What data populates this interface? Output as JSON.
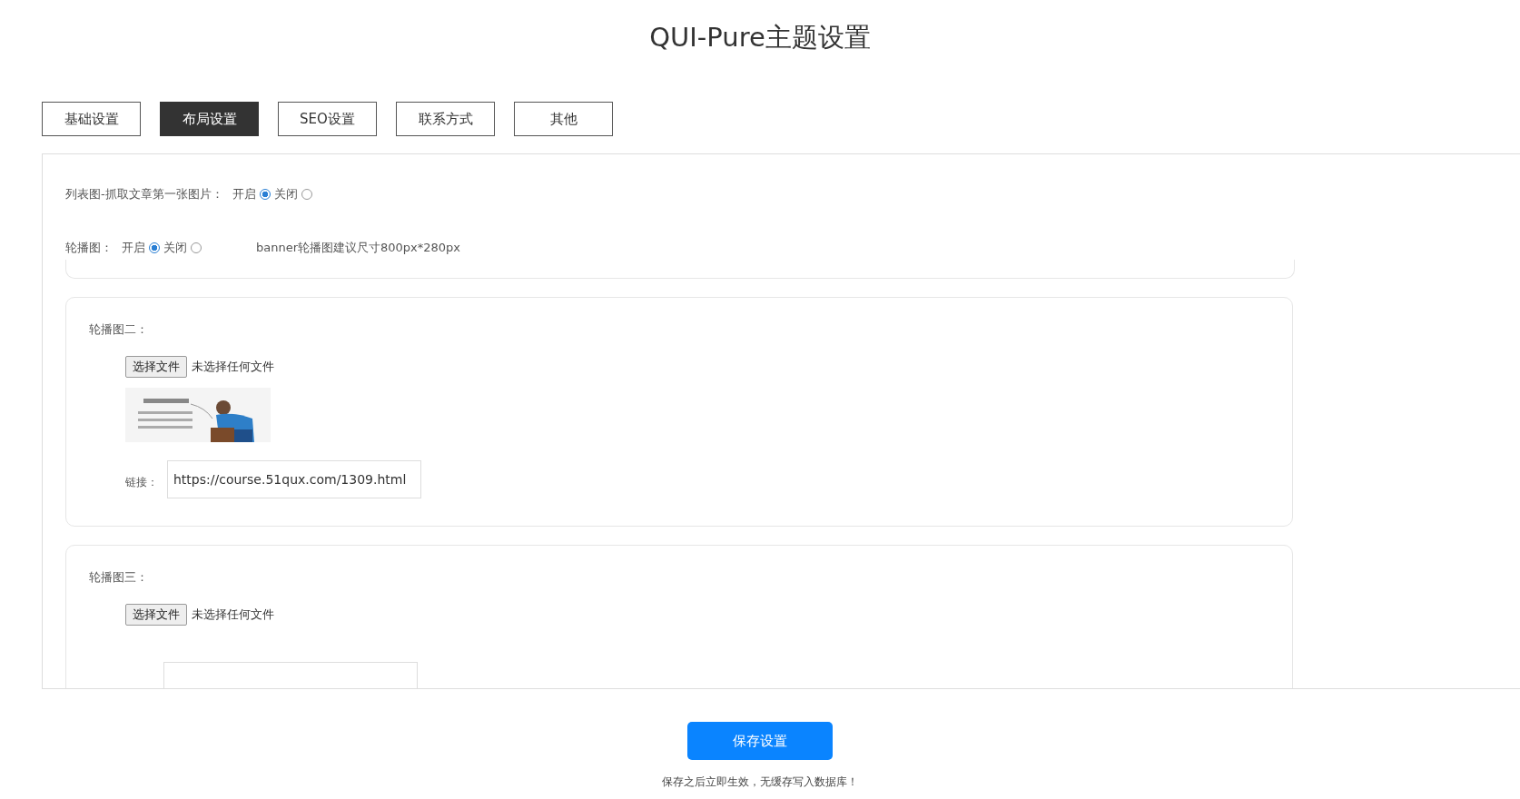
{
  "title": "QUI-Pure主题设置",
  "tabs": [
    {
      "label": "基础设置",
      "selected": false
    },
    {
      "label": "布局设置",
      "selected": true
    },
    {
      "label": "SEO设置",
      "selected": false
    },
    {
      "label": "联系方式",
      "selected": false
    },
    {
      "label": "其他",
      "selected": false
    }
  ],
  "settings": [
    {
      "label": "列表图-抓取文章第一张图片：",
      "options": [
        {
          "label": "开启",
          "selected": true
        },
        {
          "label": "关闭",
          "selected": false
        }
      ]
    },
    {
      "label": "轮播图：",
      "options": [
        {
          "label": "开启",
          "selected": true
        },
        {
          "label": "关闭",
          "selected": false
        }
      ],
      "hint": "banner轮播图建议尺寸800px*280px"
    }
  ],
  "banners": [
    {
      "title": "轮播图二：",
      "file_button": "选择文件",
      "file_status": "未选择任何文件",
      "link_label": "链接：",
      "link": "https://course.51qux.com/1309.html"
    },
    {
      "title": "轮播图三：",
      "file_button": "选择文件",
      "file_status": "未选择任何文件"
    }
  ],
  "save_button": "保存设置",
  "note": "保存之后立即生效，无缓存写入数据库！"
}
